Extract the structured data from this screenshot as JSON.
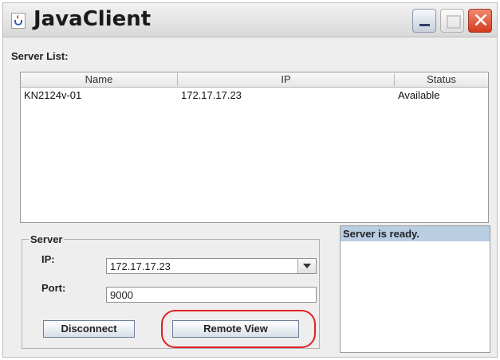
{
  "window": {
    "title": "JavaClient"
  },
  "server_list": {
    "label": "Server List:",
    "columns": [
      "Name",
      "IP",
      "Status"
    ],
    "rows": [
      {
        "name": "KN2124v-01",
        "ip": "172.17.17.23",
        "status": "Available"
      }
    ]
  },
  "server": {
    "group_title": "Server",
    "ip_label": "IP:",
    "ip_value": "172.17.17.23",
    "port_label": "Port:",
    "port_value": "9000",
    "disconnect_label": "Disconnect",
    "remote_view_label": "Remote View"
  },
  "status": {
    "message": "Server is ready."
  },
  "colors": {
    "highlight": "#e02020",
    "status_header": "#b9cde3",
    "close_button": "#d43b1e"
  },
  "icons": {
    "app": "java-cup-icon",
    "minimize": "minimize-icon",
    "maximize": "maximize-icon",
    "close": "close-icon",
    "dropdown": "chevron-down-icon"
  }
}
